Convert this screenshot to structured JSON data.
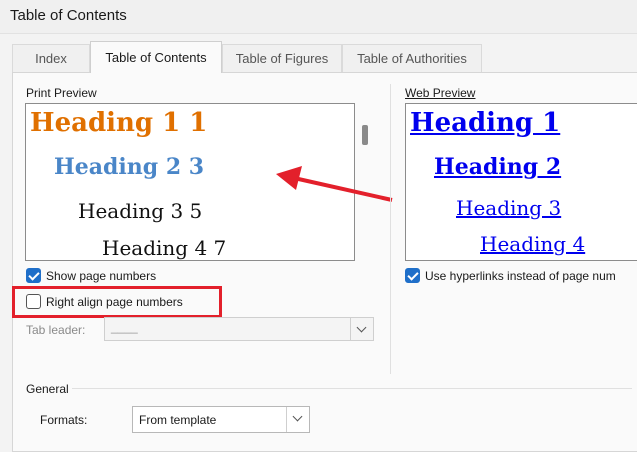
{
  "window": {
    "title": "Table of Contents"
  },
  "tabs": [
    "Index",
    "Table of Contents",
    "Table of Figures",
    "Table of Authorities"
  ],
  "print_preview": {
    "label": "Print Preview",
    "h1": "Heading 1 1",
    "h2": "Heading 2 3",
    "h3": "Heading 3 5",
    "h4": "Heading 4 7"
  },
  "web_preview": {
    "label": "Web Preview",
    "h1": "Heading 1",
    "h2": "Heading 2",
    "h3": "Heading 3",
    "h4": "Heading 4"
  },
  "options": {
    "show_page_numbers": {
      "label": "Show page numbers",
      "checked": true
    },
    "right_align": {
      "label": "Right align page numbers",
      "checked": false
    },
    "use_hyperlinks": {
      "label": "Use hyperlinks instead of page num",
      "checked": true
    },
    "tab_leader": {
      "label": "Tab leader:",
      "value": "____"
    }
  },
  "general": {
    "label": "General",
    "formats_label": "Formats:",
    "formats_value": "From template"
  },
  "colors": {
    "accent": "#1f6fc9",
    "highlight": "#e3202b",
    "h1_print": "#e07000",
    "h2_print": "#4a86c8",
    "link": "#0000ee"
  }
}
